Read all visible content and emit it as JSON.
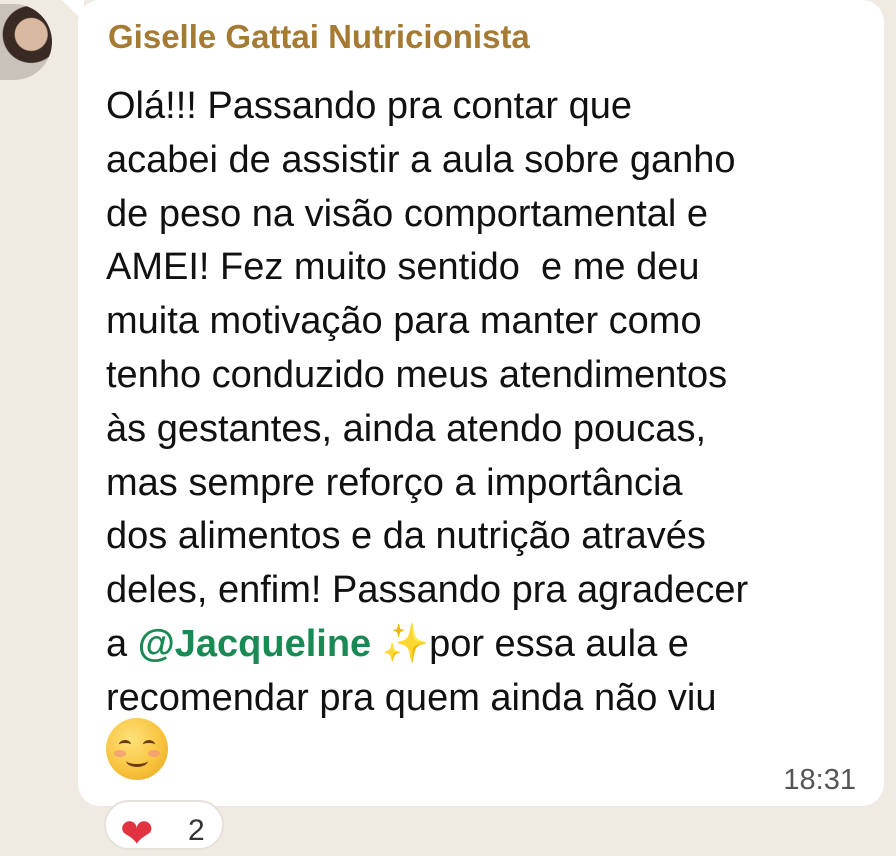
{
  "chat": {
    "sender_name": "Giselle Gattai Nutricionista",
    "message_lines": [
      "Olá!!! Passando pra contar que",
      "acabei de assistir a aula sobre ganho",
      "de peso na visão comportamental e",
      "AMEI! Fez muito sentido  e me deu",
      "muita motivação para manter como",
      "tenho conduzido meus atendimentos",
      "às gestantes, ainda atendo poucas,",
      "mas sempre reforço a importância",
      "dos alimentos e da nutrição através",
      "deles, enfim! Passando pra agradecer"
    ],
    "line_11_prefix": "a ",
    "mention": "@Jacqueline",
    "sparkle_emoji": "✨",
    "line_11_suffix": "por essa aula e",
    "line_12": "recomendar pra quem ainda não viu",
    "timestamp": "18:31",
    "reaction": {
      "emoji": "❤",
      "count": "2"
    },
    "colors": {
      "sender": "#a57a32",
      "mention": "#1a8a55",
      "background": "#efeae2",
      "bubble": "#ffffff"
    }
  }
}
